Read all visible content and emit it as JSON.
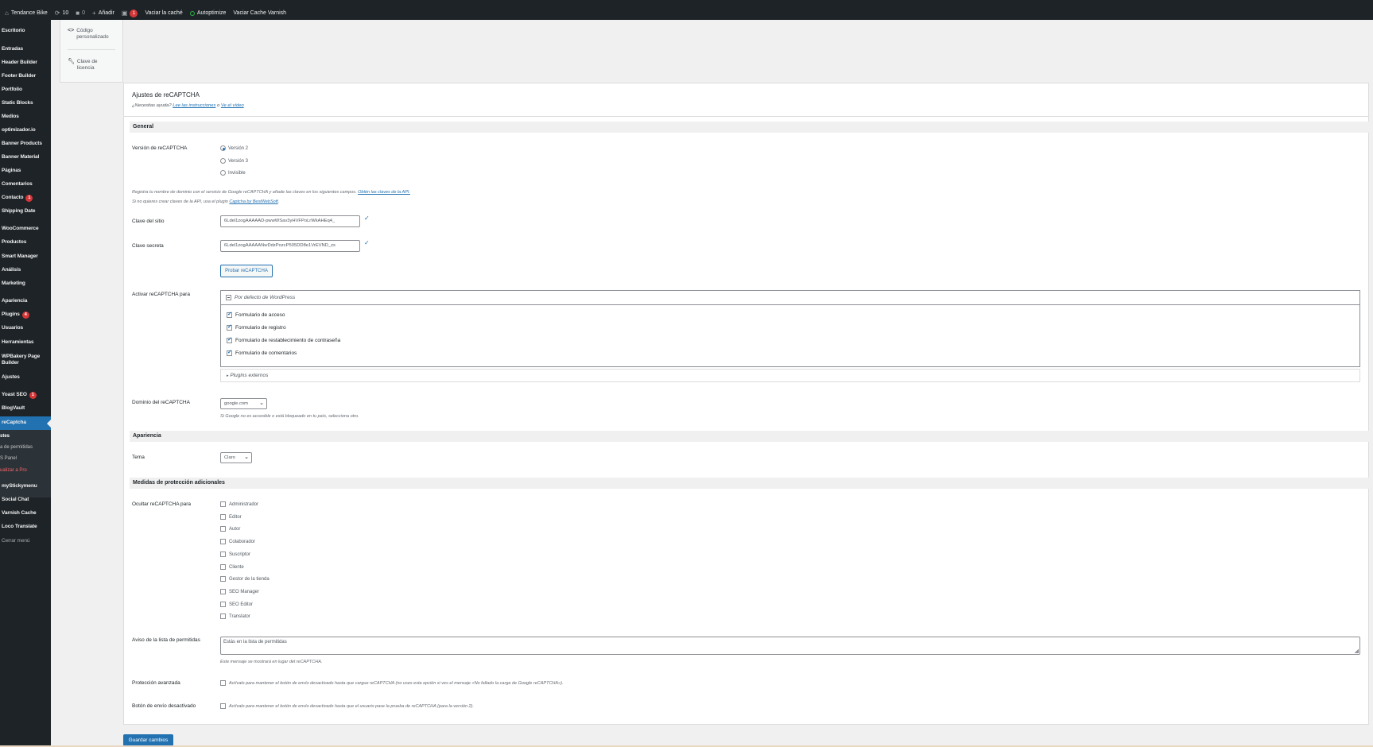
{
  "adminbar": {
    "site": "Tendance Bike",
    "updates": "10",
    "comments": "0",
    "add": "Añadir",
    "notif": "1",
    "clear_cache": "Vaciar la caché",
    "autoptimize": "Autoptimize",
    "varnish": "Vaciar Cache Varnish"
  },
  "menu": {
    "items": [
      "Escritorio",
      "Entradas",
      "Header Builder",
      "Footer Builder",
      "Portfolio",
      "Static Blocks",
      "Medios",
      "optimizador.io",
      "Banner Products",
      "Banner Material",
      "Páginas",
      "Comentarios",
      "Contacto",
      "Shipping Date",
      "WooCommerce",
      "Productos",
      "Smart Manager",
      "Análisis",
      "Marketing",
      "Apariencia",
      "Plugins",
      "Usuarios",
      "Herramientas",
      "WPBakery Page Builder",
      "Ajustes",
      "Yoast SEO",
      "BlogVault",
      "reCaptcha",
      "myStickymenu",
      "Social Chat",
      "Varnish Cache",
      "Loco Translate",
      "Cerrar menú"
    ],
    "badges": {
      "contacto": "1",
      "plugins": "4",
      "yoast": "1"
    },
    "sub": [
      "stes",
      "a de permitidas",
      "S Panel",
      "ualizar a Pro"
    ]
  },
  "tabs": {
    "custom_code": "Código personalizado",
    "license": "Clave de licencia"
  },
  "page": {
    "title": "Ajustes de reCAPTCHA",
    "help_prefix": "¿Necesitas ayuda?",
    "help_link1": "Lee las instrucciones",
    "help_or": "o",
    "help_link2": "Ve el vídeo"
  },
  "general": {
    "heading": "General",
    "version_label": "Versión de reCAPTCHA",
    "versions": [
      "Versión 2",
      "Versión 3",
      "Invisible"
    ],
    "note1_text": "Registra tu nombre de dominio con el servicio de Google reCAPTCHA y añade las claves en los siguientes campos.",
    "note1_link": "Obtén las claves de la API.",
    "note2_text": "Si no quieres crear claves de la API, usa el plugin",
    "note2_link": "Captcha by BestWebSoft",
    "site_key_label": "Clave del sitio",
    "site_key": "6Ldel1zogAAAAAD-pwwWSav3yHVFPoLrWkAHEq4_",
    "secret_key_label": "Clave secreta",
    "secret_key": "6Ldel1zogAAAAANwDdzPozcP505DD8e1VrEVND_zs",
    "test_button": "Probar reCAPTCHA",
    "enable_label": "Activar reCAPTCHA para",
    "wp_default": "Por defecto de WordPress",
    "forms": [
      "Formulario de acceso",
      "Formulario de registro",
      "Formulario de restablecimiento de contraseña",
      "Formulario de comentarios"
    ],
    "external": "Plugins externos",
    "domain_label": "Dominio del reCAPTCHA",
    "domain_value": "google.com",
    "domain_note": "Si Google no es accesible o está bloqueado en tu país, selecciona otro."
  },
  "appearance": {
    "heading": "Apariencia",
    "theme_label": "Tema",
    "theme_value": "Claro"
  },
  "extra": {
    "heading": "Medidas de protección adicionales",
    "hide_label": "Ocultar reCAPTCHA para",
    "roles": [
      "Administrador",
      "Editor",
      "Autor",
      "Colaborador",
      "Suscriptor",
      "Cliente",
      "Gestor de la tienda",
      "SEO Manager",
      "SEO Editor",
      "Translator"
    ],
    "whitelist_label": "Aviso de la lista de permitidas",
    "whitelist_value": "Estás en la lista de permitidas",
    "whitelist_note": "Este mensaje se mostrará en lugar del reCAPTCHA.",
    "advanced_label": "Protección avanzada",
    "advanced_text": "Actívalo para mantener el botón de envío desactivado hasta que cargue reCAPTCHA (no uses esta opción si ves el mensaje «No fallado la carga de Google reCAPTCHA»).",
    "disabled_label": "Botón de envío desactivado",
    "disabled_text": "Actívalo para mantener el botón de envío desactivado hasta que el usuario pase la prueba de reCAPTCHA (para la versión 2)."
  },
  "save": "Guardar cambios"
}
